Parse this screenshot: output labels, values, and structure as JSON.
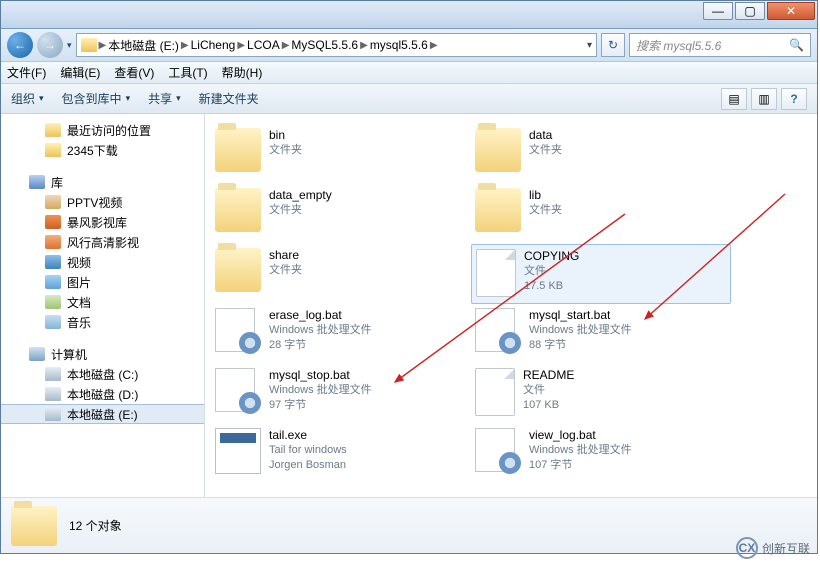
{
  "titlebar": {
    "minimize": "—",
    "maximize": "▢",
    "close": "✕"
  },
  "nav": {
    "back": "←",
    "forward": "→",
    "crumbs": [
      "本地磁盘 (E:)",
      "LiCheng",
      "LCOA",
      "MySQL5.5.6",
      "mysql5.5.6"
    ],
    "dropdown": "▾",
    "refresh": "↻",
    "search_placeholder": "搜索 mysql5.5.6",
    "search_icon": "🔍"
  },
  "menu": [
    "文件(F)",
    "编辑(E)",
    "查看(V)",
    "工具(T)",
    "帮助(H)"
  ],
  "toolbar": {
    "organize": "组织",
    "include": "包含到库中",
    "share": "共享",
    "newfolder": "新建文件夹",
    "drop": "▾",
    "view_icon": "▤",
    "preview_icon": "▥",
    "help_icon": "?"
  },
  "sidebar": {
    "favorites": [
      {
        "label": "最近访问的位置",
        "icon": "fold"
      },
      {
        "label": "2345下载",
        "icon": "fold"
      }
    ],
    "lib_header": "库",
    "libs": [
      {
        "label": "PPTV视频"
      },
      {
        "label": "暴风影视库"
      },
      {
        "label": "风行高清影视"
      },
      {
        "label": "视频"
      },
      {
        "label": "图片"
      },
      {
        "label": "文档"
      },
      {
        "label": "音乐"
      }
    ],
    "computer_header": "计算机",
    "drives": [
      {
        "label": "本地磁盘 (C:)"
      },
      {
        "label": "本地磁盘 (D:)"
      },
      {
        "label": "本地磁盘 (E:)",
        "sel": true
      }
    ]
  },
  "files": {
    "left": [
      {
        "name": "bin",
        "type": "文件夹",
        "icon": "fold"
      },
      {
        "name": "data_empty",
        "type": "文件夹",
        "icon": "fold"
      },
      {
        "name": "share",
        "type": "文件夹",
        "icon": "fold"
      },
      {
        "name": "erase_log.bat",
        "type": "Windows 批处理文件",
        "size": "28 字节",
        "icon": "gear"
      },
      {
        "name": "mysql_stop.bat",
        "type": "Windows 批处理文件",
        "size": "97 字节",
        "icon": "gear"
      },
      {
        "name": "tail.exe",
        "type": "Tail for windows",
        "size": "Jorgen Bosman",
        "icon": "exe"
      }
    ],
    "right": [
      {
        "name": "data",
        "type": "文件夹",
        "icon": "fold"
      },
      {
        "name": "lib",
        "type": "文件夹",
        "icon": "fold"
      },
      {
        "name": "COPYING",
        "type": "文件",
        "size": "17.5 KB",
        "icon": "doc",
        "sel": true
      },
      {
        "name": "mysql_start.bat",
        "type": "Windows 批处理文件",
        "size": "88 字节",
        "icon": "gear"
      },
      {
        "name": "README",
        "type": "文件",
        "size": "107 KB",
        "icon": "doc"
      },
      {
        "name": "view_log.bat",
        "type": "Windows 批处理文件",
        "size": "107 字节",
        "icon": "gear"
      }
    ]
  },
  "details": {
    "count": "12 个对象"
  },
  "watermark": {
    "brand": "创新互联",
    "initials": "CX"
  }
}
